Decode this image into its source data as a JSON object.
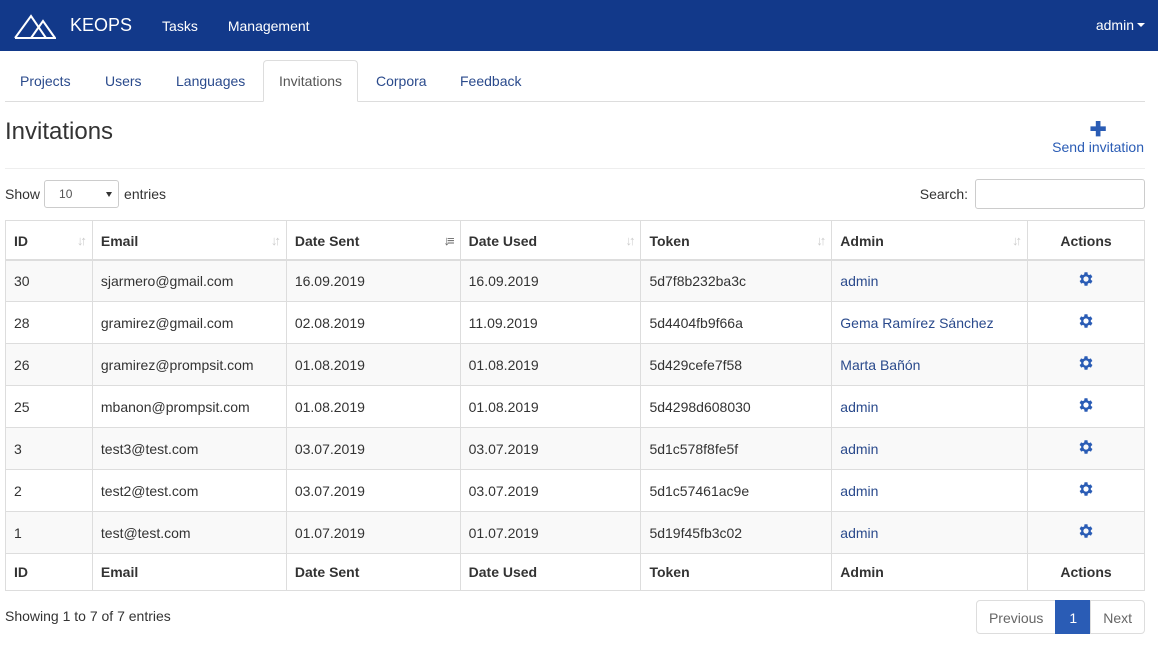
{
  "navbar": {
    "brand": "KEOPS",
    "links": [
      "Tasks",
      "Management"
    ],
    "user": "admin",
    "bg_color": "#12398a"
  },
  "tabs": [
    {
      "label": "Projects",
      "active": false
    },
    {
      "label": "Users",
      "active": false
    },
    {
      "label": "Languages",
      "active": false
    },
    {
      "label": "Invitations",
      "active": true
    },
    {
      "label": "Corpora",
      "active": false
    },
    {
      "label": "Feedback",
      "active": false
    }
  ],
  "page": {
    "title": "Invitations",
    "send_invitation": "Send invitation",
    "send_icon": "plus-icon"
  },
  "controls": {
    "show_label": "Show",
    "entries_value": "10",
    "entries_label": "entries",
    "search_label": "Search:",
    "search_value": ""
  },
  "table": {
    "columns": [
      "ID",
      "Email",
      "Date Sent",
      "Date Used",
      "Token",
      "Admin",
      "Actions"
    ],
    "sorted_column": "Date Sent",
    "action_icon": "gear-icon",
    "rows": [
      {
        "id": "30",
        "email": "sjarmero@gmail.com",
        "date_sent": "16.09.2019",
        "date_used": "16.09.2019",
        "token": "5d7f8b232ba3c",
        "admin": "admin"
      },
      {
        "id": "28",
        "email": "gramirez@gmail.com",
        "date_sent": "02.08.2019",
        "date_used": "11.09.2019",
        "token": "5d4404fb9f66a",
        "admin": "Gema Ramírez Sánchez"
      },
      {
        "id": "26",
        "email": "gramirez@prompsit.com",
        "date_sent": "01.08.2019",
        "date_used": "01.08.2019",
        "token": "5d429cefe7f58",
        "admin": "Marta Bañón"
      },
      {
        "id": "25",
        "email": "mbanon@prompsit.com",
        "date_sent": "01.08.2019",
        "date_used": "01.08.2019",
        "token": "5d4298d608030",
        "admin": "admin"
      },
      {
        "id": "3",
        "email": "test3@test.com",
        "date_sent": "03.07.2019",
        "date_used": "03.07.2019",
        "token": "5d1c578f8fe5f",
        "admin": "admin"
      },
      {
        "id": "2",
        "email": "test2@test.com",
        "date_sent": "03.07.2019",
        "date_used": "03.07.2019",
        "token": "5d1c57461ac9e",
        "admin": "admin"
      },
      {
        "id": "1",
        "email": "test@test.com",
        "date_sent": "01.07.2019",
        "date_used": "01.07.2019",
        "token": "5d19f45fb3c02",
        "admin": "admin"
      }
    ]
  },
  "footer": {
    "info": "Showing 1 to 7 of 7 entries",
    "pagination": {
      "previous": "Previous",
      "current": "1",
      "next": "Next"
    }
  },
  "colors": {
    "link": "#2a4a8c",
    "accent": "#2a5cb5"
  }
}
